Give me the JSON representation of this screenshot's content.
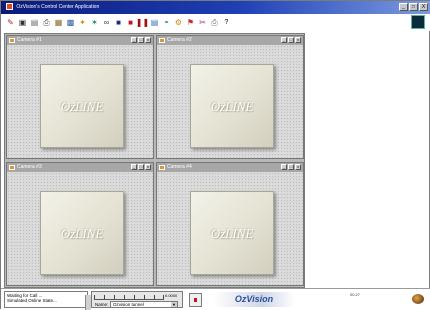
{
  "window": {
    "title": "OzVision's Control Center Application",
    "controls": [
      "_",
      "□",
      "X"
    ]
  },
  "toolbar": {
    "icons": [
      "tool-icon",
      "camera-icon",
      "document-icon",
      "printer-icon",
      "gallery-icon",
      "window-icon",
      "wand-icon",
      "star-icon",
      "glasses-icon",
      "monitor-icon",
      "record-icon",
      "pause-icon",
      "chart-icon",
      "map-icon",
      "settings-icon",
      "flag-icon",
      "cut-icon",
      "print-icon",
      "help-icon"
    ],
    "help_label": "?"
  },
  "cameras": [
    {
      "title": "Camera #1",
      "logo": "OzLINE"
    },
    {
      "title": "Camera #2",
      "logo": "OzLINE"
    },
    {
      "title": "Camera #3",
      "logo": "OzLINE"
    },
    {
      "title": "Camera #4",
      "logo": "OzLINE"
    }
  ],
  "status": {
    "messages": [
      "Waiting for Call ...",
      "Simulated Online State..."
    ],
    "zoom_value": "0.0000",
    "name_label": "Name:",
    "name_value": "Ozvision tunnel",
    "brand": "OzVision",
    "version": "00.27"
  },
  "colors": {
    "titlebar": "#1e3fb5",
    "camera_header": "#a7a7a7",
    "record": "#c8102e",
    "brand": "#2a4f9e"
  }
}
